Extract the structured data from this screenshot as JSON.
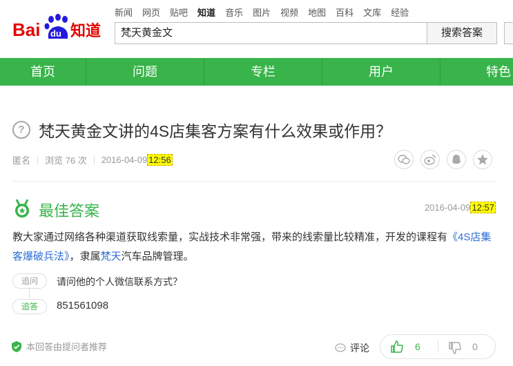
{
  "header": {
    "logo_text": "Baidu知道",
    "top_nav": [
      {
        "label": "新闻",
        "active": false
      },
      {
        "label": "网页",
        "active": false
      },
      {
        "label": "贴吧",
        "active": false
      },
      {
        "label": "知道",
        "active": true
      },
      {
        "label": "音乐",
        "active": false
      },
      {
        "label": "图片",
        "active": false
      },
      {
        "label": "视频",
        "active": false
      },
      {
        "label": "地图",
        "active": false
      },
      {
        "label": "百科",
        "active": false
      },
      {
        "label": "文库",
        "active": false
      },
      {
        "label": "经验",
        "active": false
      }
    ],
    "search_value": "梵天黄金文",
    "search_button": "搜索答案"
  },
  "green_nav": [
    "首页",
    "问题",
    "专栏",
    "用户",
    "特色"
  ],
  "question": {
    "title": "梵天黄金文讲的4S店集客方案有什么效果或作用？",
    "author": "匿名",
    "views": "浏览 76 次",
    "date": "2016-04-09",
    "time": "12:56"
  },
  "best_answer": {
    "heading": "最佳答案",
    "date": "2016-04-09",
    "time": "12:57",
    "body_1": "教大家通过网络各种渠道获取线索量，实战技术非常强，带来的线索量比较精准，开发的课程有",
    "link_1": "《4S店集客爆破兵法》",
    "body_2": "，隶属",
    "link_2": "梵天",
    "body_3": "汽车品牌管理。",
    "follow_tag": "追问",
    "follow_text": "请问他的个人微信联系方式？",
    "reply_tag": "追答",
    "reply_text": "851561098"
  },
  "footer": {
    "recommend": "本回答由提问者推荐",
    "comment": "评论",
    "up_count": "6",
    "down_count": "0"
  },
  "colors": {
    "brand_green": "#38b44a",
    "baidu_red": "#e10602",
    "baidu_blue": "#2319dc",
    "highlight": "#fffe00"
  }
}
